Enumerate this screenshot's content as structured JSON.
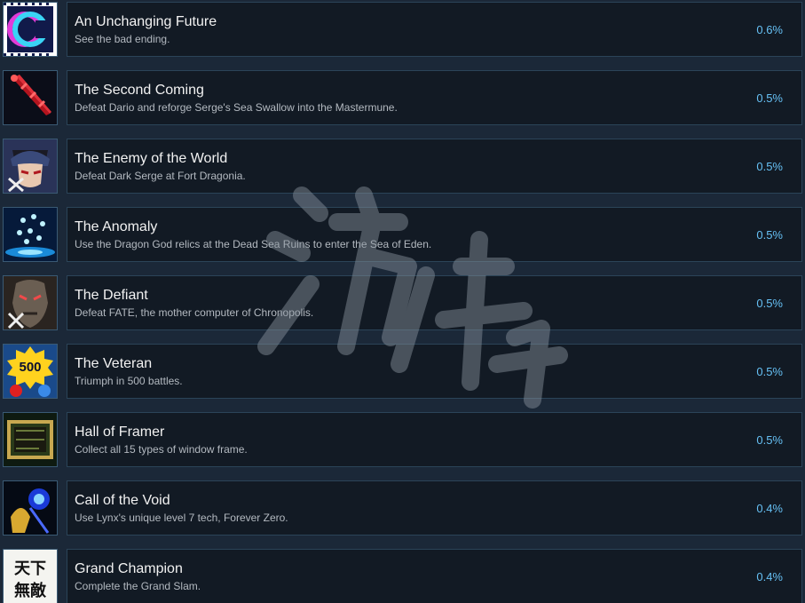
{
  "achievements": [
    {
      "title": "An Unchanging Future",
      "description": "See the bad ending.",
      "percent": "0.6%",
      "icon": "ending-icon"
    },
    {
      "title": "The Second Coming",
      "description": "Defeat Dario and reforge Serge's Sea Swallow into the Mastermune.",
      "percent": "0.5%",
      "icon": "mastermune-sword-icon"
    },
    {
      "title": "The Enemy of the World",
      "description": "Defeat Dark Serge at Fort Dragonia.",
      "percent": "0.5%",
      "icon": "dark-serge-icon"
    },
    {
      "title": "The Anomaly",
      "description": "Use the Dragon God relics at the Dead Sea Ruins to enter the Sea of Eden.",
      "percent": "0.5%",
      "icon": "sea-of-eden-icon"
    },
    {
      "title": "The Defiant",
      "description": "Defeat FATE, the mother computer of Chronopolis.",
      "percent": "0.5%",
      "icon": "fate-icon"
    },
    {
      "title": "The Veteran",
      "description": "Triumph in 500 battles.",
      "percent": "0.5%",
      "icon": "500-battles-icon",
      "badge_text": "500"
    },
    {
      "title": "Hall of Framer",
      "description": "Collect all 15 types of window frame.",
      "percent": "0.5%",
      "icon": "window-frame-icon"
    },
    {
      "title": "Call of the Void",
      "description": "Use Lynx's unique level 7 tech, Forever Zero.",
      "percent": "0.4%",
      "icon": "lynx-icon"
    },
    {
      "title": "Grand Champion",
      "description": "Complete the Grand Slam.",
      "percent": "0.4%",
      "icon": "grand-champion-icon",
      "badge_text": "天下無敵"
    }
  ],
  "colors": {
    "background": "#1b2838",
    "card": "#121a24",
    "card_border": "#2b4458",
    "percent": "#66c0f4"
  },
  "watermark": {
    "text": "游侠网",
    "icon": "watermark-logo"
  }
}
